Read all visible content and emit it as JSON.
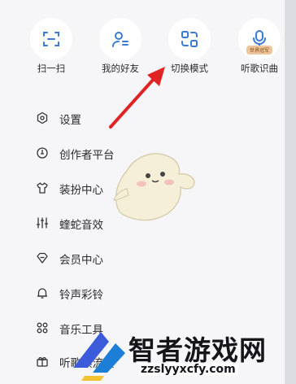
{
  "quick_actions": [
    {
      "label": "扫一扫",
      "icon": "scan-icon"
    },
    {
      "label": "我的好友",
      "icon": "friends-icon"
    },
    {
      "label": "切换模式",
      "icon": "switch-mode-icon"
    },
    {
      "label": "听歌识曲",
      "icon": "recognize-song-icon",
      "badge": "世界冠军"
    }
  ],
  "menu": [
    {
      "label": "设置",
      "icon": "settings-icon"
    },
    {
      "label": "创作者平台",
      "icon": "creator-icon"
    },
    {
      "label": "装扮中心",
      "icon": "shirt-icon"
    },
    {
      "label": "蝰蛇音效",
      "icon": "equalizer-icon"
    },
    {
      "label": "会员中心",
      "icon": "diamond-icon"
    },
    {
      "label": "铃声彩铃",
      "icon": "bell-icon"
    },
    {
      "label": "音乐工具",
      "icon": "grid-icon"
    },
    {
      "label": "听歌领流量",
      "icon": "gift-icon"
    }
  ],
  "watermark": {
    "title": "智者游戏网",
    "url": "zzslyyxcfy.com"
  },
  "colors": {
    "accent": "#3a7bd5",
    "arrow": "#e02424",
    "badge": "#f0c49a"
  }
}
